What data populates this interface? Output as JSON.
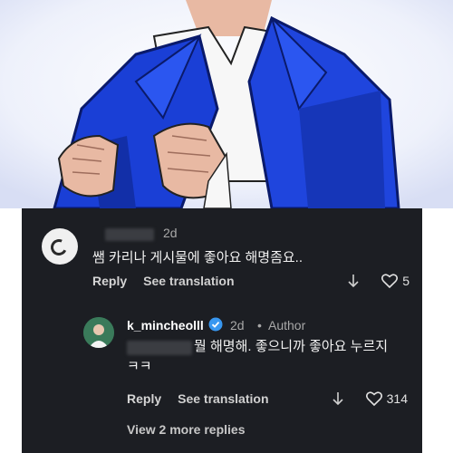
{
  "comments": [
    {
      "time": "2d",
      "text": "쌤 카리나 게시물에 좋아요 해명좀요..",
      "reply_label": "Reply",
      "translate_label": "See translation",
      "likes": "5"
    },
    {
      "username": "k_mincheolll",
      "time": "2d",
      "separator": "•",
      "author_badge": "Author",
      "text": "뭘 해명해. 좋으니까 좋아요 누르지 ㅋㅋ",
      "reply_label": "Reply",
      "translate_label": "See translation",
      "likes": "314"
    }
  ],
  "view_more": "View 2 more replies",
  "colors": {
    "panel_bg": "#1c1e23",
    "suit_blue": "#1a3fd6",
    "verified_blue": "#3897f0"
  },
  "icons": [
    "down-arrow-icon",
    "heart-icon",
    "verified-badge-icon"
  ]
}
